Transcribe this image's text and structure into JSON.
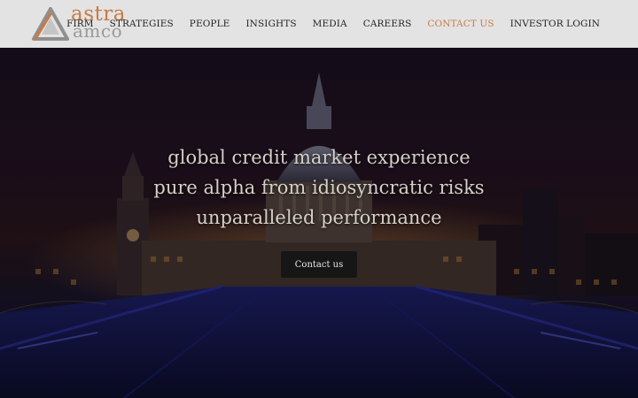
{
  "brand": {
    "logo_line1": "astra",
    "logo_line2": "amco",
    "logo_color": "#c97a45",
    "logo_icon": "triangle-logo-icon"
  },
  "nav": {
    "items": [
      {
        "label": "FIRM"
      },
      {
        "label": "STRATEGIES"
      },
      {
        "label": "PEOPLE"
      },
      {
        "label": "INSIGHTS"
      },
      {
        "label": "MEDIA"
      },
      {
        "label": "CAREERS"
      },
      {
        "label": "CONTACT US"
      },
      {
        "label": "INVESTOR LOGIN"
      }
    ],
    "active_label": "CONTACT US",
    "active_color": "#c97a45"
  },
  "hero": {
    "lines": [
      "global credit market experience",
      "pure alpha from idiosyncratic risks",
      "unparalleled performance"
    ],
    "cta_label": "Contact us"
  }
}
